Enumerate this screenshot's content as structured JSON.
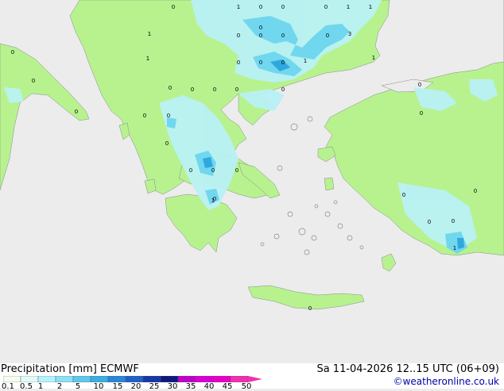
{
  "footer": {
    "title": "Precipitation [mm] ECMWF",
    "datetime": "Sa 11-04-2026 12..15 UTC (06+09)",
    "credit": "©weatheronline.co.uk"
  },
  "legend": {
    "ticks": [
      "0.1",
      "0.5",
      "1",
      "2",
      "5",
      "10",
      "15",
      "20",
      "25",
      "30",
      "35",
      "40",
      "45",
      "50"
    ],
    "colors": [
      "#f5fff0",
      "#e0fcf8",
      "#b5f2ff",
      "#8be0f5",
      "#5fc8ea",
      "#3aaee0",
      "#2a86d8",
      "#2060c8",
      "#1838a8",
      "#101880",
      "#c000c8",
      "#d800d8",
      "#e800c8",
      "#f030b0"
    ]
  },
  "map": {
    "land_color": "#b7f28f",
    "sea_color": "#ececec",
    "rain_light_color": "#b9f1f6",
    "rain_mid_color": "#70d7ef",
    "rain_heavy_color": "#2fa8dd",
    "value_labels": [
      "0",
      "1",
      "0",
      "0",
      "0",
      "1",
      "1",
      "1",
      "0",
      "0",
      "0",
      "0",
      "3",
      "0",
      "1",
      "0",
      "0",
      "0",
      "1",
      "1",
      "0",
      "0",
      "0",
      "0",
      "0",
      "0",
      "0",
      "0",
      "0",
      "0",
      "0",
      "0",
      "0",
      "0",
      "0",
      "0",
      "0",
      "0",
      "0",
      "0",
      "1",
      "0",
      "0",
      "1",
      "0",
      "0",
      "0",
      "0"
    ]
  }
}
